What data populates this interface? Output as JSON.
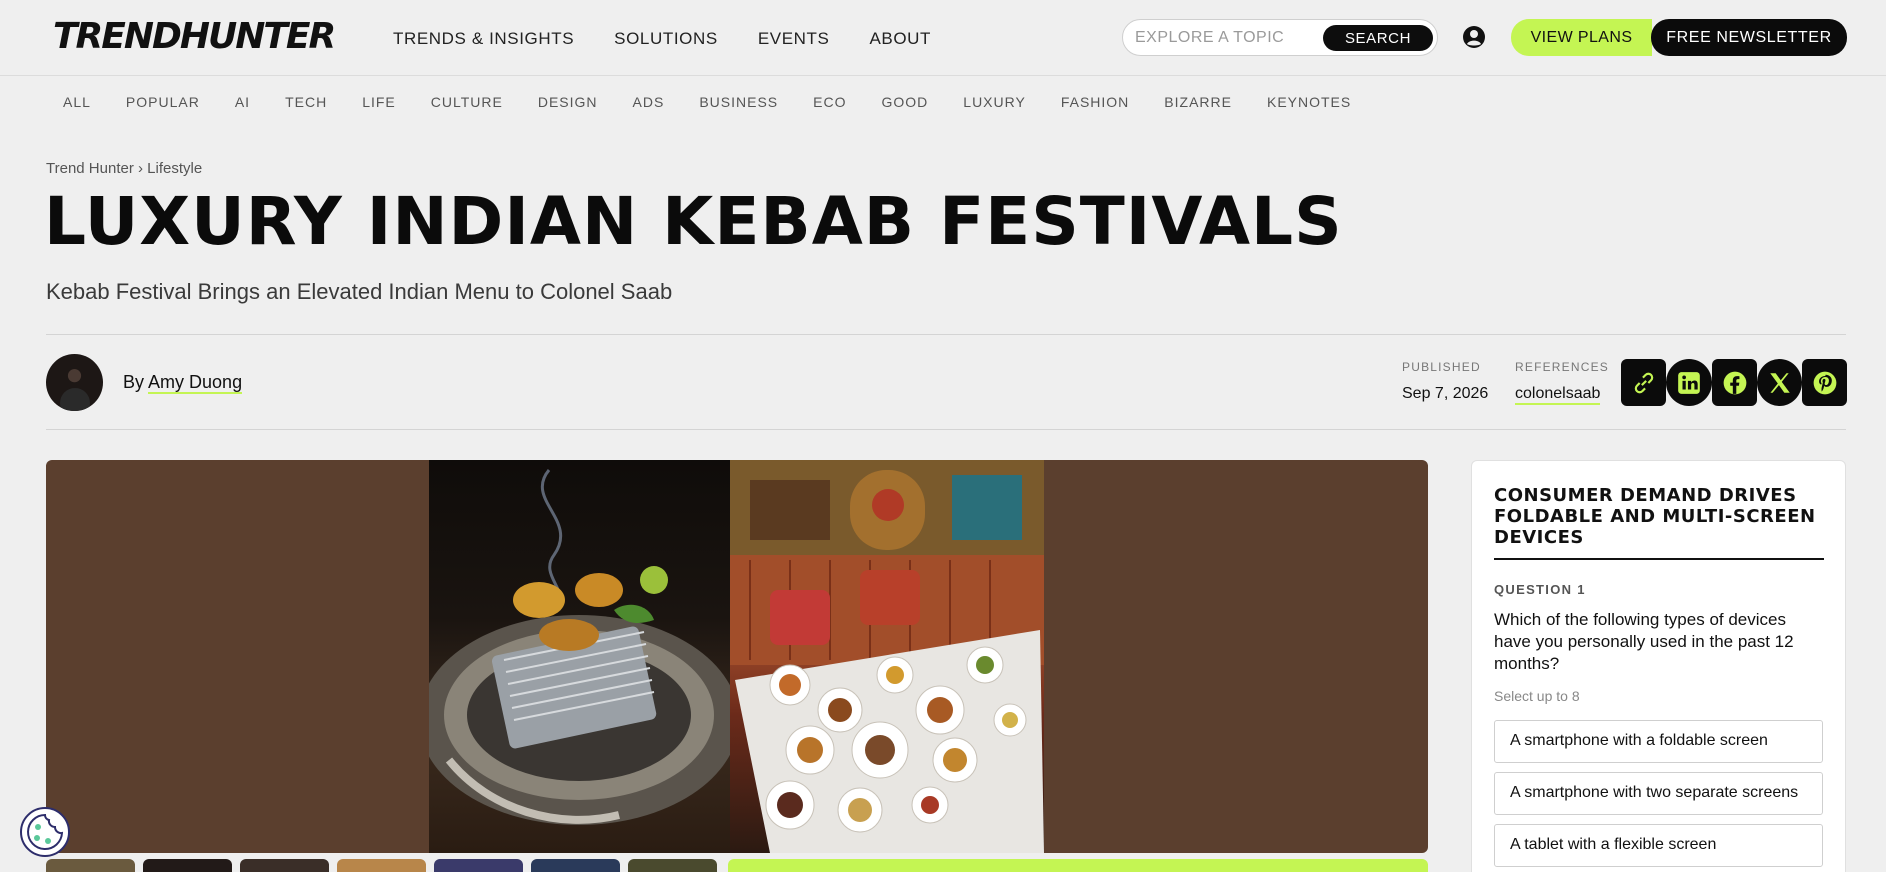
{
  "header": {
    "logo": "TRENDHUNTER",
    "nav": [
      "TRENDS & INSIGHTS",
      "SOLUTIONS",
      "EVENTS",
      "ABOUT"
    ],
    "search_placeholder": "EXPLORE A TOPIC",
    "search_button": "SEARCH",
    "view_plans": "VIEW PLANS",
    "newsletter": "FREE NEWSLETTER"
  },
  "categories": [
    "ALL",
    "POPULAR",
    "AI",
    "TECH",
    "LIFE",
    "CULTURE",
    "DESIGN",
    "ADS",
    "BUSINESS",
    "ECO",
    "GOOD",
    "LUXURY",
    "FASHION",
    "BIZARRE",
    "KEYNOTES"
  ],
  "breadcrumb": {
    "root": "Trend Hunter",
    "separator": "›",
    "section": "Lifestyle"
  },
  "article": {
    "title": "LUXURY INDIAN KEBAB FESTIVALS",
    "subtitle": "Kebab Festival Brings an Elevated Indian Menu to Colonel Saab",
    "by": "By",
    "author": "Amy Duong",
    "published_label": "PUBLISHED",
    "published_date": "Sep 7, 2026",
    "references_label": "REFERENCES",
    "reference": "colonelsaab"
  },
  "share": [
    "link-icon",
    "linkedin-icon",
    "facebook-icon",
    "x-icon",
    "pinterest-icon"
  ],
  "colors": {
    "accent": "#c4f553",
    "dark": "#0b0b0b",
    "hero_bg": "#5b3f2e"
  },
  "poll": {
    "title": "CONSUMER DEMAND DRIVES FOLDABLE AND MULTI-SCREEN DEVICES",
    "question_label": "QUESTION 1",
    "question": "Which of the following types of devices have you personally used in the past 12 months?",
    "hint": "Select up to 8",
    "options": [
      "A smartphone with a foldable screen",
      "A smartphone with two separate screens",
      "A tablet with a flexible screen"
    ]
  }
}
